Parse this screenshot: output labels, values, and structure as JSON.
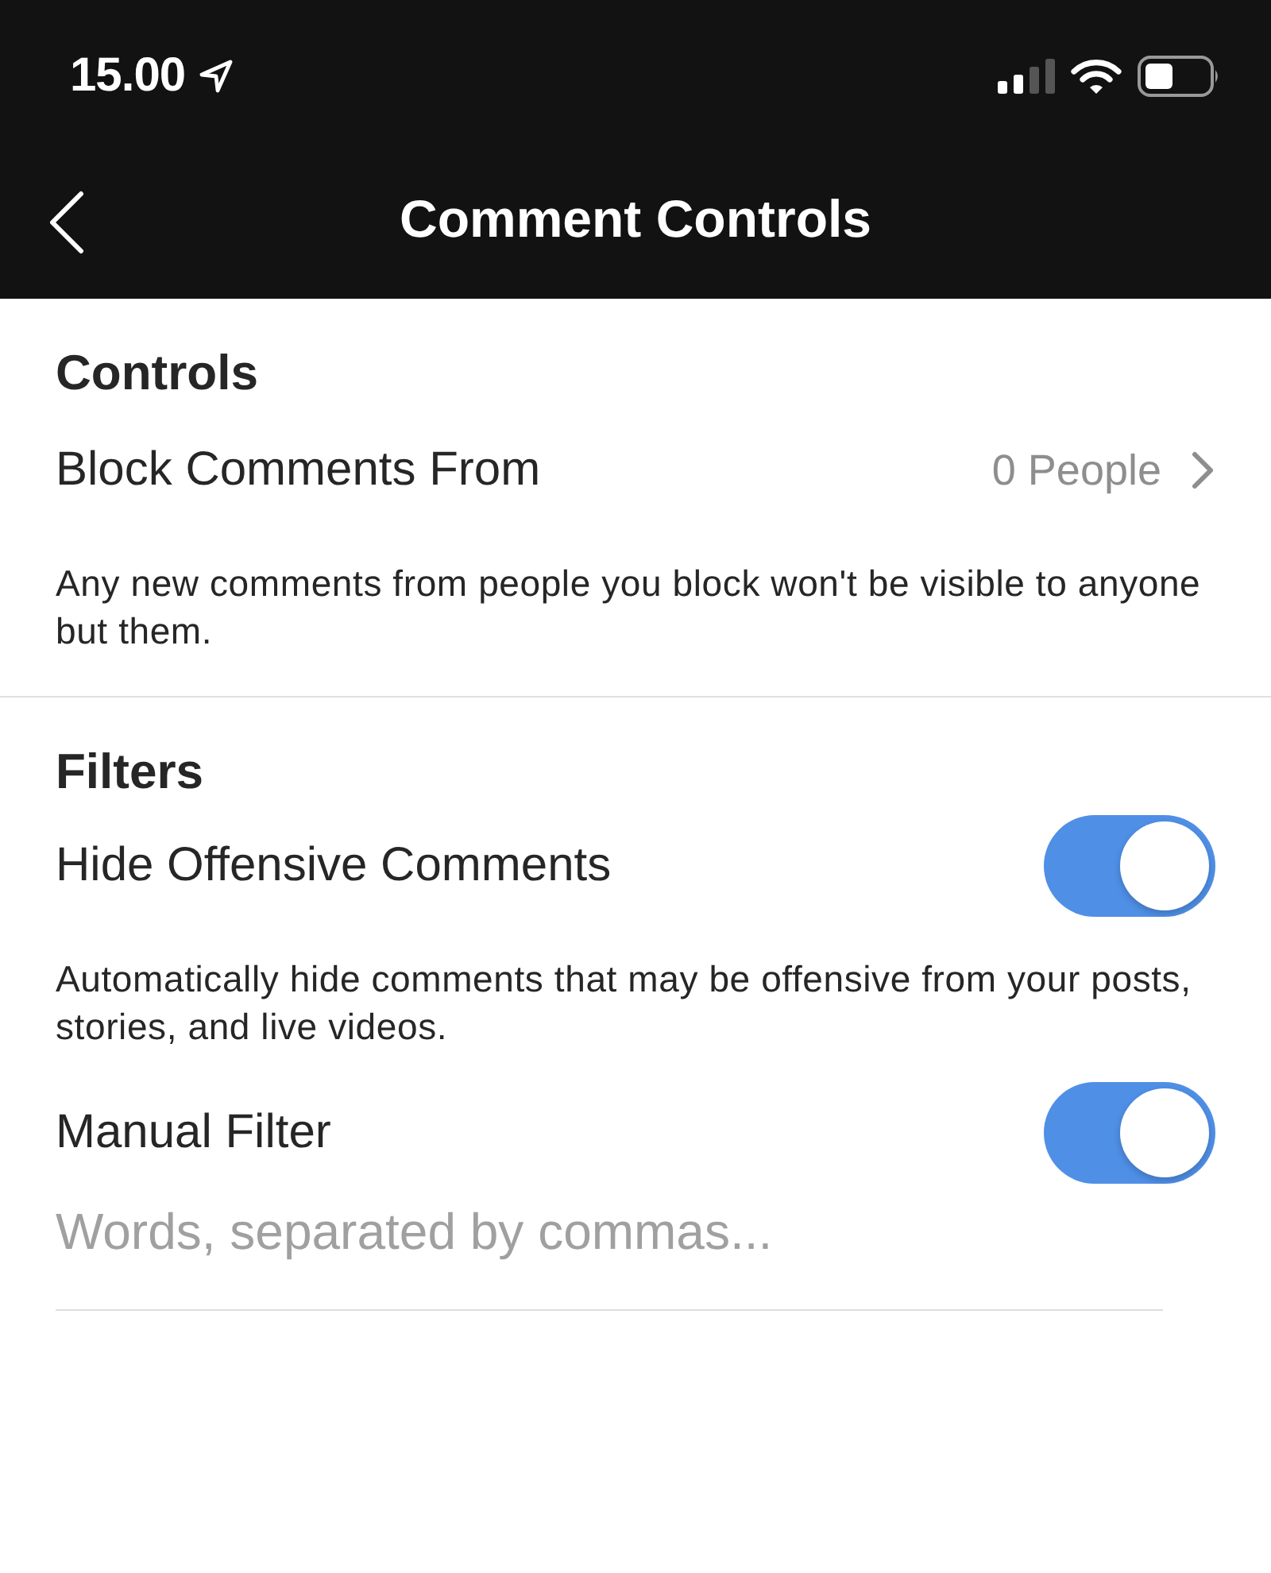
{
  "status_bar": {
    "time": "15.00"
  },
  "nav": {
    "title": "Comment Controls"
  },
  "sections": [
    {
      "title": "Controls",
      "items": [
        {
          "kind": "link",
          "label": "Block Comments From",
          "value": "0 People",
          "note": "Any new comments from people you block won't be visible to anyone but them."
        }
      ]
    },
    {
      "title": "Filters",
      "items": [
        {
          "kind": "toggle",
          "label": "Hide Offensive Comments",
          "on": true,
          "note": "Automatically hide comments that may be offensive from your posts, stories, and live videos."
        },
        {
          "kind": "toggle",
          "label": "Manual Filter",
          "on": true
        },
        {
          "kind": "field",
          "placeholder": "Words, separated by commas..."
        }
      ]
    }
  ]
}
